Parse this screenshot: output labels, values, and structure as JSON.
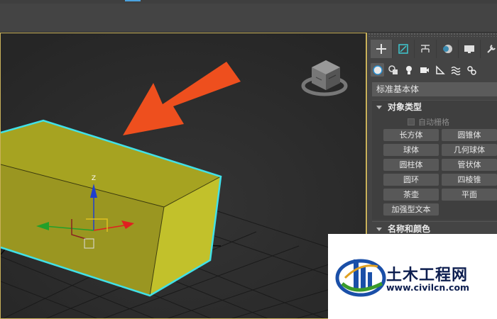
{
  "panel": {
    "create_tabs": [
      {
        "icon": "plus-icon"
      },
      {
        "icon": "modify-icon"
      },
      {
        "icon": "hierarchy-icon"
      },
      {
        "icon": "motion-icon"
      },
      {
        "icon": "display-icon"
      },
      {
        "icon": "utilities-wrench-icon"
      }
    ],
    "categories": [
      {
        "icon": "geometry-sphere-icon"
      },
      {
        "icon": "shapes-icon"
      },
      {
        "icon": "lights-icon"
      },
      {
        "icon": "cameras-icon"
      },
      {
        "icon": "helpers-icon"
      },
      {
        "icon": "spacewarps-icon"
      },
      {
        "icon": "systems-icon"
      }
    ],
    "dropdown_value": "标准基本体",
    "object_type": {
      "title": "对象类型",
      "autogrid_label": "自动栅格",
      "buttons": [
        "长方体",
        "圆锥体",
        "球体",
        "几何球体",
        "圆柱体",
        "管状体",
        "圆环",
        "四棱锥",
        "茶壶",
        "平面",
        "加强型文本"
      ]
    },
    "name_color": {
      "title": "名称和颜色"
    }
  },
  "viewport": {
    "object_color": "#b8b82a",
    "selection_color": "#41e1e8",
    "arrow_color": "#ee4f1e",
    "axis_label": "Z"
  },
  "watermark": {
    "title": "土木工程网",
    "url": "www.civilcn.com"
  }
}
